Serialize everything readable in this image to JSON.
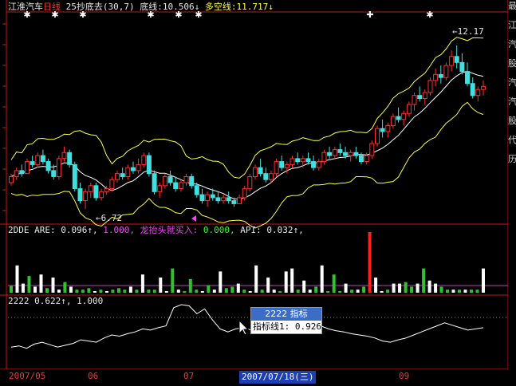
{
  "header": {
    "stock": "江淮汽车",
    "period": "日线",
    "indicator": "25抄底去(30,7)",
    "bottom_label": "底线:",
    "bottom_value": "10.506↓",
    "longshort_label": "多空线:",
    "longshort_value": "11.717↓"
  },
  "sub1": {
    "name": "2DDE ARE:",
    "v1": "0.096↑,",
    "v2": "1.000,",
    "dragon_label": "龙抬头就买入:",
    "dragon_value": "0.000,",
    "api_label": "API:",
    "api_value": "0.032↑,"
  },
  "sub2": {
    "name": "2222",
    "v1": "0.622↑,",
    "v2": "1.000"
  },
  "tooltip": {
    "title": "2222 指标",
    "line": "指标线1: 0.926"
  },
  "date_axis": {
    "labels": [
      "2007/05",
      "06",
      "07",
      "09"
    ],
    "cursor": "2007/07/18(三)"
  },
  "right_strip_chars": "最\n江\n汽\n股\n汽\n汽\n股\n代\n历",
  "colors": {
    "up": "#ff3030",
    "down": "#40e0e0",
    "band": "#ffff40",
    "mid": "#ffffff",
    "green": "#30c030"
  },
  "chart_data": [
    {
      "type": "candlestick",
      "title": "江淮汽车 日线",
      "annotations": [
        {
          "text": "6.72",
          "role": "low"
        },
        {
          "text": "12.17",
          "role": "high"
        }
      ],
      "ylim": [
        6.3,
        13.2
      ],
      "candles": [
        [
          7.6,
          7.9,
          7.5,
          7.8
        ],
        [
          7.8,
          8.1,
          7.7,
          8.0
        ],
        [
          8.0,
          8.2,
          7.8,
          7.9
        ],
        [
          7.9,
          8.4,
          7.9,
          8.3
        ],
        [
          8.3,
          8.5,
          8.1,
          8.2
        ],
        [
          8.2,
          8.6,
          8.1,
          8.5
        ],
        [
          8.5,
          8.7,
          8.2,
          8.3
        ],
        [
          8.3,
          8.4,
          7.9,
          8.0
        ],
        [
          8.0,
          8.2,
          7.7,
          7.8
        ],
        [
          7.8,
          8.5,
          7.7,
          8.4
        ],
        [
          8.4,
          8.8,
          8.3,
          8.6
        ],
        [
          8.6,
          8.7,
          8.1,
          8.2
        ],
        [
          8.2,
          8.3,
          7.3,
          7.4
        ],
        [
          7.4,
          7.6,
          6.9,
          7.0
        ],
        [
          7.0,
          7.4,
          6.72,
          7.3
        ],
        [
          7.3,
          7.6,
          7.1,
          7.5
        ],
        [
          7.5,
          7.6,
          7.0,
          7.1
        ],
        [
          7.1,
          7.4,
          7.0,
          7.3
        ],
        [
          7.3,
          7.5,
          7.2,
          7.4
        ],
        [
          7.4,
          7.8,
          7.3,
          7.7
        ],
        [
          7.7,
          8.0,
          7.6,
          7.9
        ],
        [
          7.9,
          8.1,
          7.7,
          7.8
        ],
        [
          7.8,
          8.2,
          7.7,
          8.1
        ],
        [
          8.1,
          8.3,
          7.9,
          8.0
        ],
        [
          8.0,
          8.4,
          7.9,
          8.2
        ],
        [
          8.2,
          8.6,
          8.1,
          8.5
        ],
        [
          8.5,
          8.6,
          7.8,
          7.9
        ],
        [
          7.9,
          8.0,
          7.2,
          7.3
        ],
        [
          7.3,
          7.6,
          7.1,
          7.5
        ],
        [
          7.5,
          7.9,
          7.4,
          7.8
        ],
        [
          7.8,
          8.0,
          7.5,
          7.6
        ],
        [
          7.6,
          7.8,
          7.3,
          7.4
        ],
        [
          7.4,
          7.7,
          7.3,
          7.6
        ],
        [
          7.6,
          7.9,
          7.5,
          7.8
        ],
        [
          7.8,
          7.9,
          7.4,
          7.5
        ],
        [
          7.5,
          7.6,
          7.1,
          7.2
        ],
        [
          7.2,
          7.4,
          6.9,
          7.0
        ],
        [
          7.0,
          7.3,
          6.8,
          7.2
        ],
        [
          7.2,
          7.4,
          7.0,
          7.1
        ],
        [
          7.1,
          7.3,
          6.9,
          7.0
        ],
        [
          7.0,
          7.2,
          6.9,
          7.1
        ],
        [
          7.1,
          7.3,
          6.9,
          7.0
        ],
        [
          7.0,
          7.1,
          6.8,
          6.9
        ],
        [
          6.9,
          7.2,
          6.9,
          7.1
        ],
        [
          7.1,
          7.5,
          7.0,
          7.4
        ],
        [
          7.4,
          7.9,
          7.3,
          7.8
        ],
        [
          7.8,
          8.2,
          7.7,
          8.1
        ],
        [
          8.1,
          8.4,
          7.8,
          7.9
        ],
        [
          7.9,
          8.1,
          7.6,
          7.7
        ],
        [
          7.7,
          8.0,
          7.6,
          7.9
        ],
        [
          7.9,
          8.4,
          7.8,
          8.3
        ],
        [
          8.3,
          8.5,
          8.0,
          8.1
        ],
        [
          8.1,
          8.3,
          7.9,
          8.2
        ],
        [
          8.2,
          8.5,
          8.1,
          8.4
        ],
        [
          8.4,
          8.6,
          8.2,
          8.3
        ],
        [
          8.3,
          8.5,
          8.1,
          8.4
        ],
        [
          8.4,
          8.6,
          8.2,
          8.3
        ],
        [
          8.3,
          8.5,
          8.0,
          8.1
        ],
        [
          8.1,
          8.4,
          8.0,
          8.3
        ],
        [
          8.3,
          8.7,
          8.2,
          8.6
        ],
        [
          8.6,
          8.8,
          8.4,
          8.5
        ],
        [
          8.5,
          8.8,
          8.4,
          8.7
        ],
        [
          8.7,
          8.9,
          8.5,
          8.6
        ],
        [
          8.6,
          8.8,
          8.4,
          8.5
        ],
        [
          8.5,
          8.7,
          8.3,
          8.6
        ],
        [
          8.6,
          8.8,
          8.4,
          8.5
        ],
        [
          8.5,
          8.6,
          8.2,
          8.3
        ],
        [
          8.3,
          8.6,
          8.2,
          8.5
        ],
        [
          8.5,
          9.0,
          8.4,
          8.9
        ],
        [
          8.9,
          9.5,
          8.8,
          9.4
        ],
        [
          9.4,
          9.7,
          9.1,
          9.3
        ],
        [
          9.3,
          9.6,
          9.1,
          9.5
        ],
        [
          9.5,
          9.9,
          9.4,
          9.8
        ],
        [
          9.8,
          10.1,
          9.6,
          9.7
        ],
        [
          9.7,
          10.0,
          9.5,
          9.9
        ],
        [
          9.9,
          10.3,
          9.8,
          10.2
        ],
        [
          10.2,
          10.6,
          10.0,
          10.5
        ],
        [
          10.5,
          10.8,
          10.3,
          10.4
        ],
        [
          10.4,
          10.7,
          10.2,
          10.6
        ],
        [
          10.6,
          11.1,
          10.5,
          11.0
        ],
        [
          11.0,
          11.4,
          10.8,
          11.2
        ],
        [
          11.2,
          11.5,
          10.9,
          11.1
        ],
        [
          11.1,
          11.6,
          11.0,
          11.5
        ],
        [
          11.5,
          12.0,
          11.3,
          11.8
        ],
        [
          11.8,
          12.17,
          11.4,
          11.6
        ],
        [
          11.6,
          11.9,
          11.2,
          11.3
        ],
        [
          11.3,
          11.6,
          10.8,
          10.9
        ],
        [
          10.9,
          11.1,
          10.4,
          10.5
        ],
        [
          10.5,
          10.8,
          10.3,
          10.7
        ],
        [
          10.7,
          11.0,
          10.5,
          10.8
        ]
      ]
    },
    {
      "type": "bar",
      "series": [
        {
          "values": [
            0.22,
            0.9,
            0.3,
            0.55,
            0.2,
            0.6,
            0.15,
            0.5,
            0.1,
            0.35,
            0.2,
            0.1,
            0.1,
            0.15,
            0.05,
            0.1,
            0.05,
            0.1,
            0.15,
            0.1,
            0.2,
            0.1,
            0.6,
            0.1,
            0.1,
            0.5,
            0.05,
            0.8,
            0.1,
            0.05,
            0.45,
            0.1,
            0.05,
            0.25,
            0.1,
            0.7,
            0.15,
            0.2,
            0.3,
            0.1,
            0.05,
            0.9,
            0.1,
            0.5,
            0.1,
            0.05,
            0.7,
            0.8,
            0.1,
            0.4,
            0.1,
            0.2,
            0.9,
            0.05,
            0.6,
            0.05,
            0.3,
            0.1,
            0.1,
            0.2,
            2.0,
            0.5,
            0.05,
            0.1,
            0.3,
            0.3,
            0.35,
            0.2,
            0.3,
            0.8,
            0.4,
            0.3,
            0.2,
            0.1,
            0.1,
            0.1,
            0.1,
            0.1,
            0.1,
            0.8
          ]
        }
      ]
    },
    {
      "type": "line",
      "series": [
        {
          "values": [
            0.3,
            0.32,
            0.28,
            0.35,
            0.38,
            0.34,
            0.3,
            0.33,
            0.36,
            0.42,
            0.4,
            0.38,
            0.45,
            0.5,
            0.48,
            0.52,
            0.55,
            0.6,
            0.58,
            0.62,
            0.65,
            0.95,
            1.0,
            0.98,
            0.85,
            0.93,
            0.75,
            0.6,
            0.55,
            0.6,
            0.62,
            0.58,
            0.55,
            0.6,
            0.58,
            0.56,
            0.52,
            0.55,
            0.58,
            0.62,
            0.65,
            0.6,
            0.57,
            0.55,
            0.52,
            0.5,
            0.48,
            0.45,
            0.4,
            0.38,
            0.42,
            0.45,
            0.5,
            0.55,
            0.6,
            0.65,
            0.7,
            0.66,
            0.62,
            0.58,
            0.6,
            0.62
          ]
        }
      ]
    }
  ]
}
